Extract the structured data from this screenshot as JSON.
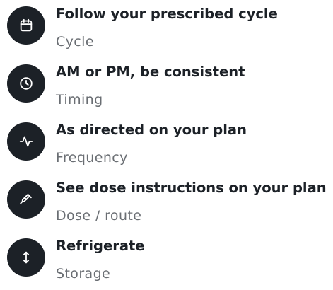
{
  "items": [
    {
      "icon": "calendar-icon",
      "title": "Follow your prescribed cycle",
      "subtitle": "Cycle"
    },
    {
      "icon": "clock-icon",
      "title": "AM or PM, be consistent",
      "subtitle": "Timing"
    },
    {
      "icon": "pulse-icon",
      "title": "As directed on your plan",
      "subtitle": "Frequency"
    },
    {
      "icon": "syringe-icon",
      "title": "See dose instructions on your plan",
      "subtitle": "Dose / route"
    },
    {
      "icon": "vertical-arrows-icon",
      "title": "Refrigerate",
      "subtitle": "Storage"
    }
  ],
  "colors": {
    "icon_background": "#1c2127",
    "icon_foreground": "#ffffff",
    "title_text": "#1c2127",
    "subtitle_text": "#6a6e73"
  }
}
